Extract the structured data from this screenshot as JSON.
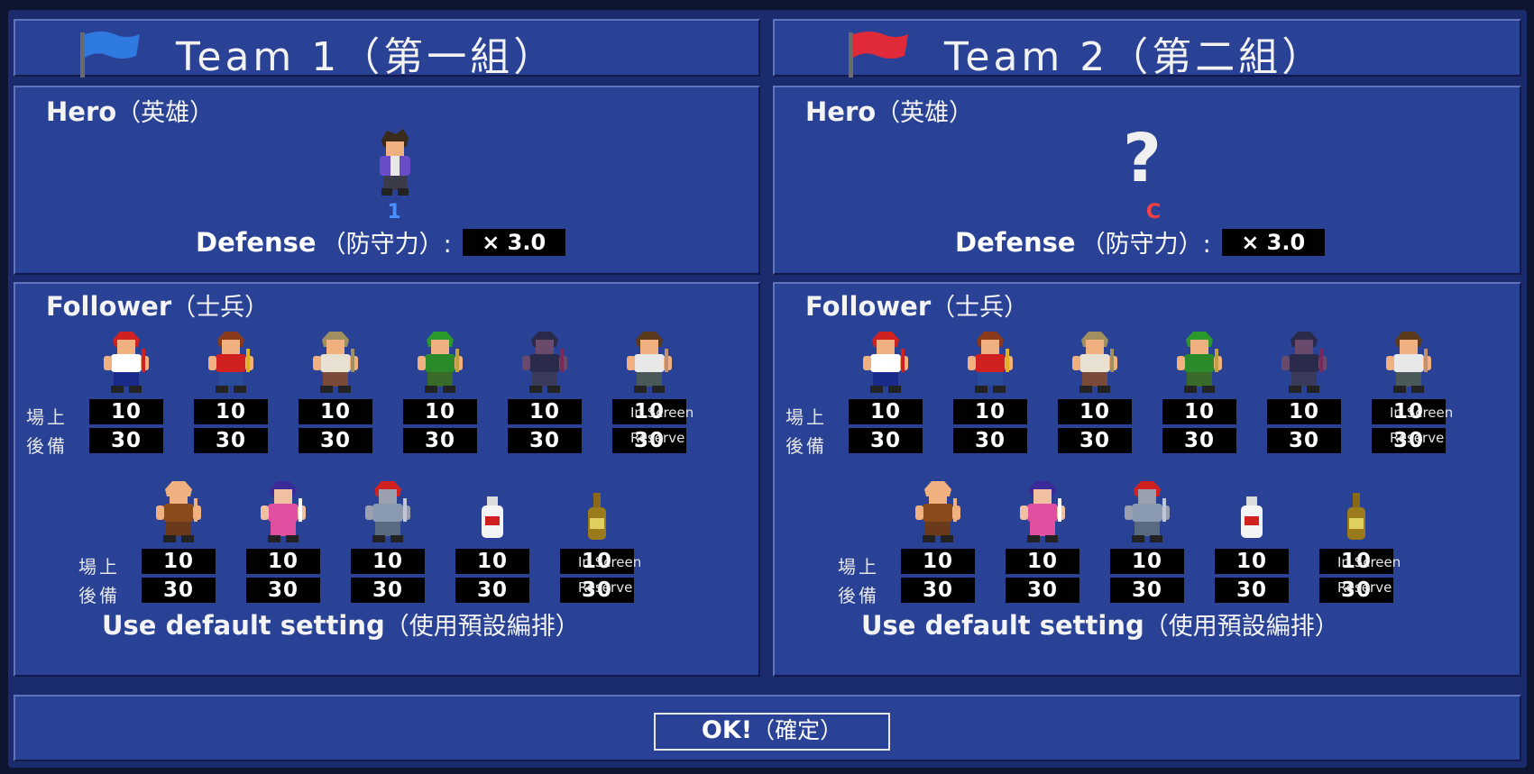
{
  "teams": [
    {
      "title": "Team 1（第一組）",
      "flag_color": "#2f7ae0",
      "hero": {
        "label": "Hero",
        "label_cn": "（英雄）",
        "selected": "character-sprite",
        "id_text": "1",
        "id_color": "#4a90ff"
      },
      "defense": {
        "label": "Defense",
        "label_cn": "（防守力）:",
        "value": "× 3.0"
      },
      "follower_label": "Follower",
      "follower_label_cn": "（士兵）",
      "row1": [
        {
          "name": "bandit",
          "in_screen": "10",
          "reserve": "30"
        },
        {
          "name": "hunter",
          "in_screen": "10",
          "reserve": "30"
        },
        {
          "name": "mark",
          "in_screen": "10",
          "reserve": "30"
        },
        {
          "name": "green-archer",
          "in_screen": "10",
          "reserve": "30"
        },
        {
          "name": "ninja",
          "in_screen": "10",
          "reserve": "30"
        },
        {
          "name": "fighter",
          "in_screen": "10",
          "reserve": "30"
        }
      ],
      "row2": [
        {
          "name": "monk",
          "in_screen": "10",
          "reserve": "30"
        },
        {
          "name": "princess",
          "in_screen": "10",
          "reserve": "30"
        },
        {
          "name": "knight",
          "in_screen": "10",
          "reserve": "30"
        },
        {
          "name": "milk-bottle",
          "in_screen": "10",
          "reserve": "30"
        },
        {
          "name": "beer-bottle",
          "in_screen": "10",
          "reserve": "30"
        }
      ],
      "default_label": "Use default setting",
      "default_label_cn": "（使用預設編排）"
    },
    {
      "title": "Team 2（第二組）",
      "flag_color": "#e02a3a",
      "hero": {
        "label": "Hero",
        "label_cn": "（英雄）",
        "selected": "question-mark",
        "symbol": "?",
        "id_text": "C",
        "id_color": "#ff4040"
      },
      "defense": {
        "label": "Defense",
        "label_cn": "（防守力）:",
        "value": "× 3.0"
      },
      "follower_label": "Follower",
      "follower_label_cn": "（士兵）",
      "row1": [
        {
          "name": "bandit",
          "in_screen": "10",
          "reserve": "30"
        },
        {
          "name": "hunter",
          "in_screen": "10",
          "reserve": "30"
        },
        {
          "name": "mark",
          "in_screen": "10",
          "reserve": "30"
        },
        {
          "name": "green-archer",
          "in_screen": "10",
          "reserve": "30"
        },
        {
          "name": "ninja",
          "in_screen": "10",
          "reserve": "30"
        },
        {
          "name": "fighter",
          "in_screen": "10",
          "reserve": "30"
        }
      ],
      "row2": [
        {
          "name": "monk",
          "in_screen": "10",
          "reserve": "30"
        },
        {
          "name": "princess",
          "in_screen": "10",
          "reserve": "30"
        },
        {
          "name": "knight",
          "in_screen": "10",
          "reserve": "30"
        },
        {
          "name": "milk-bottle",
          "in_screen": "10",
          "reserve": "30"
        },
        {
          "name": "beer-bottle",
          "in_screen": "10",
          "reserve": "30"
        }
      ],
      "default_label": "Use default setting",
      "default_label_cn": "（使用預設編排）"
    }
  ],
  "labels": {
    "in_screen_cn": "場上",
    "reserve_cn": "後備",
    "in_screen": "In Screen",
    "reserve": "Reserve"
  },
  "ok_button": {
    "label": "OK!",
    "label_cn": "（確定）"
  }
}
